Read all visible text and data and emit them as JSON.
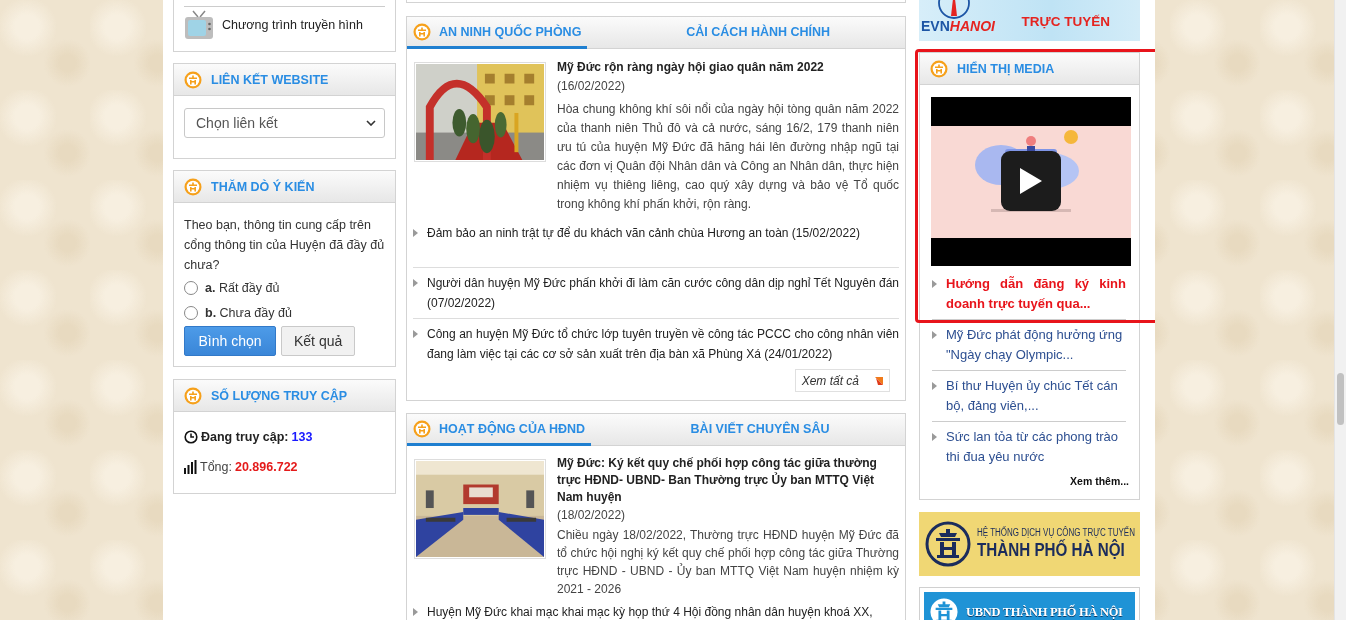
{
  "left": {
    "tv_link": {
      "label": "Chương trình truyền hình"
    },
    "link_panel": {
      "title": "LIÊN KẾT WEBSITE",
      "select": {
        "value": "Chọn liên kết"
      }
    },
    "poll_panel": {
      "title": "THĂM DÒ Ý KIẾN",
      "question": "Theo bạn, thông tin cung cấp trên cổng thông tin của Huyện đã đầy đủ chưa?",
      "options": [
        {
          "label": "**a.** Rất đầy đủ",
          "selected": false
        },
        {
          "label": "**b.** Chưa đầy đủ",
          "selected": false
        }
      ],
      "buttons": [
        {
          "label": "Bình chọn",
          "kind": "primary"
        },
        {
          "label": "Kết quả",
          "kind": "secondary"
        }
      ]
    },
    "stats_panel": {
      "title": "SỐ LƯỢNG TRUY CẬP",
      "rows": [
        {
          "kind": "online",
          "label": "Đang truy cập:",
          "value": "133"
        },
        {
          "kind": "total",
          "label": "Tổng:",
          "value": "20.896.722"
        }
      ]
    }
  },
  "news_panels": [
    {
      "tabs": [
        {
          "label": "AN NINH QUỐC PHÒNG",
          "selected": true
        },
        {
          "label": "CẢI CÁCH HÀNH CHÍNH",
          "selected": false
        }
      ],
      "featured": {
        "kind": "parade",
        "title": "Mỹ Đức rộn ràng ngày hội giao quân năm 2022",
        "date": "(16/02/2022)",
        "summary": "Hòa chung không khí sôi nổi của ngày hội tòng quân năm 2022 của thanh niên Thủ đô và cả nước, sáng 16/2, 179 thanh niên ưu tú của huyện Mỹ Đức đã hăng hái lên đường nhập ngũ tại các đơn vị Quân đội Nhân dân và Công an Nhân dân, thực hiện nhiệm vụ thiêng liêng, cao quý xây dựng và bảo vệ Tổ quốc trong không khí phấn khởi, rộn ràng."
      },
      "items": [
        "Đảm bảo an ninh trật tự để du khách vãn cảnh chùa Hương an toàn (15/02/2022)",
        "Người dân huyện Mỹ Đức phấn khởi đi làm căn cước công dân dịp nghỉ Tết Nguyên đán (07/02/2022)",
        "Công an huyện Mỹ Đức tổ chức lớp tuyên truyền về công tác PCCC cho công nhân viên đang làm việc tại các cơ sở sản xuất trên địa bàn xã Phùng Xá (24/01/2022)"
      ],
      "more": "Xem tất cả"
    },
    {
      "tabs": [
        {
          "label": "HOẠT ĐỘNG CỦA HĐND",
          "selected": true
        },
        {
          "label": "BÀI VIẾT CHUYÊN SÂU",
          "selected": false
        }
      ],
      "featured": {
        "kind": "meeting",
        "title": "Mỹ Đức: Ký kết quy chế phối hợp công tác giữa thường trực HĐND- UBND- Ban Thường trực Ủy ban MTTQ Việt Nam huyện",
        "date": "(18/02/2022)",
        "summary": "Chiều ngày 18/02/2022, Thường trực HĐND huyện Mỹ Đức đã tổ chức hội nghị ký kết quy chế phối hợp công tác giữa Thường trực HĐND - UBND - Ủy ban MTTQ Việt Nam huyện nhiệm kỳ 2021 - 2026"
      },
      "items": [
        "Huyện Mỹ Đức khai mạc khai mạc kỳ họp thứ 4 Hội đồng nhân dân huyện khoá XX,"
      ]
    }
  ],
  "right": {
    "evn_banner": {
      "brand": "EVN",
      "brand_accent": "HANOI",
      "caption": "TRỰC TUYẾN"
    },
    "media_panel": {
      "title": "HIỂN THỊ MEDIA",
      "highlighted": true,
      "items": [
        {
          "text": "Hướng dẫn đăng ký kinh doanh trực tuyến qua...",
          "selected": true
        },
        {
          "text": "Mỹ Đức phát động hưởng ứng \"Ngày chạy Olympic...",
          "selected": false
        },
        {
          "text": "Bí thư Huyện ủy chúc Tết cán bộ, đảng viên,...",
          "selected": false
        },
        {
          "text": "Sức lan tỏa từ các phong trào thi đua yêu nước",
          "selected": false
        }
      ],
      "more": "Xem thêm..."
    },
    "service_banners": [
      {
        "kind": "services",
        "lines": [
          "HỆ THỐNG DỊCH VỤ CÔNG TRỰC TUYẾN",
          "THÀNH PHỐ HÀ NỘI"
        ]
      },
      {
        "kind": "city",
        "lines": [
          "UBND THÀNH PHỐ HÀ NỘI"
        ]
      }
    ]
  }
}
